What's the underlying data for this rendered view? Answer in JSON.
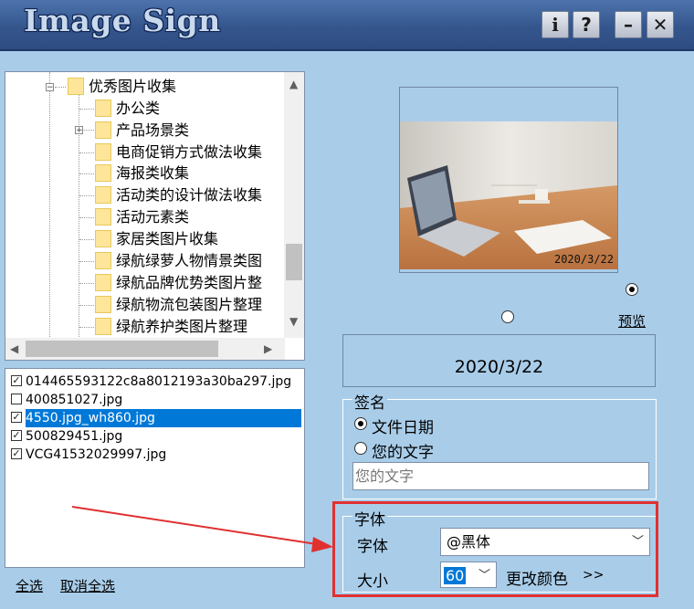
{
  "title": "Image Sign",
  "title_buttons": {
    "info": "i",
    "help": "?",
    "minimize": "–",
    "close": "✕"
  },
  "tree": {
    "root": "优秀图片收集",
    "items": [
      "办公类",
      "产品场景类",
      "电商促销方式做法收集",
      "海报类收集",
      "活动类的设计做法收集",
      "活动元素类",
      "家居类图片收集",
      "绿航绿萝人物情景类图",
      "绿航品牌优势类图片整",
      "绿航物流包装图片整理",
      "绿航养护类图片整理"
    ]
  },
  "files": [
    {
      "name": "014465593122c8a8012193a30ba297.jpg",
      "checked": true,
      "selected": false
    },
    {
      "name": "400851027.jpg",
      "checked": false,
      "selected": false
    },
    {
      "name": "4550.jpg_wh860.jpg",
      "checked": true,
      "selected": true
    },
    {
      "name": "500829451.jpg",
      "checked": true,
      "selected": false
    },
    {
      "name": "VCG41532029997.jpg",
      "checked": true,
      "selected": false
    }
  ],
  "select_all": "全选",
  "deselect_all": "取消全选",
  "preview": {
    "stamp": "2020/3/22",
    "link": "预览"
  },
  "date_display": "2020/3/22",
  "signature": {
    "title": "签名",
    "option_date": "文件日期",
    "option_text": "您的文字",
    "placeholder": "您的文字"
  },
  "font_group": {
    "title": "字体",
    "font_label": "字体",
    "font_value": "@黑体",
    "size_label": "大小",
    "size_value": "60",
    "change_color": "更改颜色",
    "more": ">>"
  },
  "colors": {
    "background": "#a9cde9",
    "titlebar": "#35568d",
    "annotation": "#e03030",
    "selection": "#0078d7"
  }
}
